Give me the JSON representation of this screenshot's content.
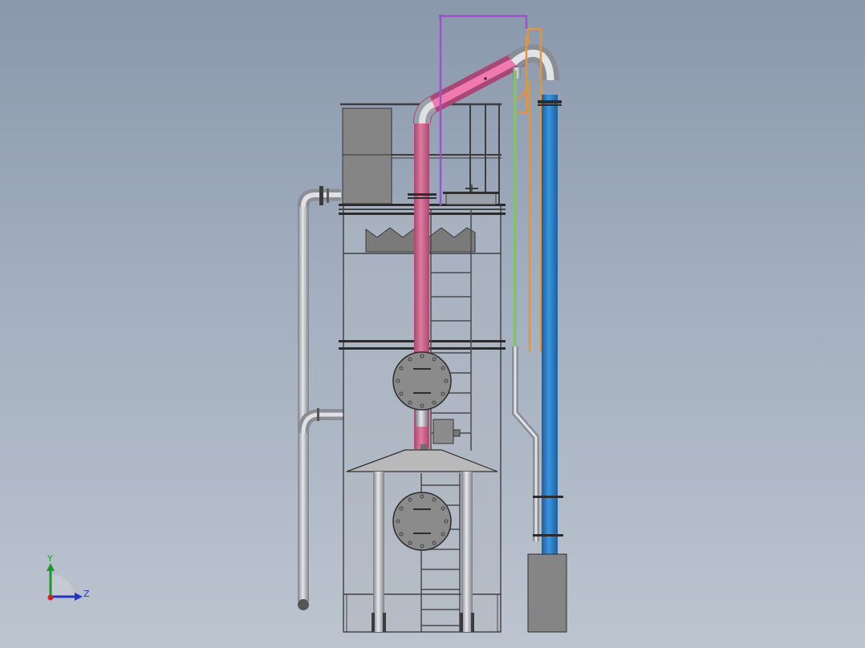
{
  "triad": {
    "y_label": "Y",
    "z_label": "Z"
  },
  "colors": {
    "background_top": "#8a98ac",
    "background_bottom": "#bcc4cf",
    "steel": "#c2c5cb",
    "steel_dark": "#6e7177",
    "panel_gray": "#858585",
    "pink_pipe": "#d9628f",
    "blue_pipe": "#2d7fc8",
    "green_pipe": "#86c06a",
    "orange_pipe": "#e0963e",
    "purple_pipe": "#9c52c9",
    "axis_y": "#1a9a2a",
    "axis_z": "#2233cc",
    "axis_x": "#cc2222"
  }
}
